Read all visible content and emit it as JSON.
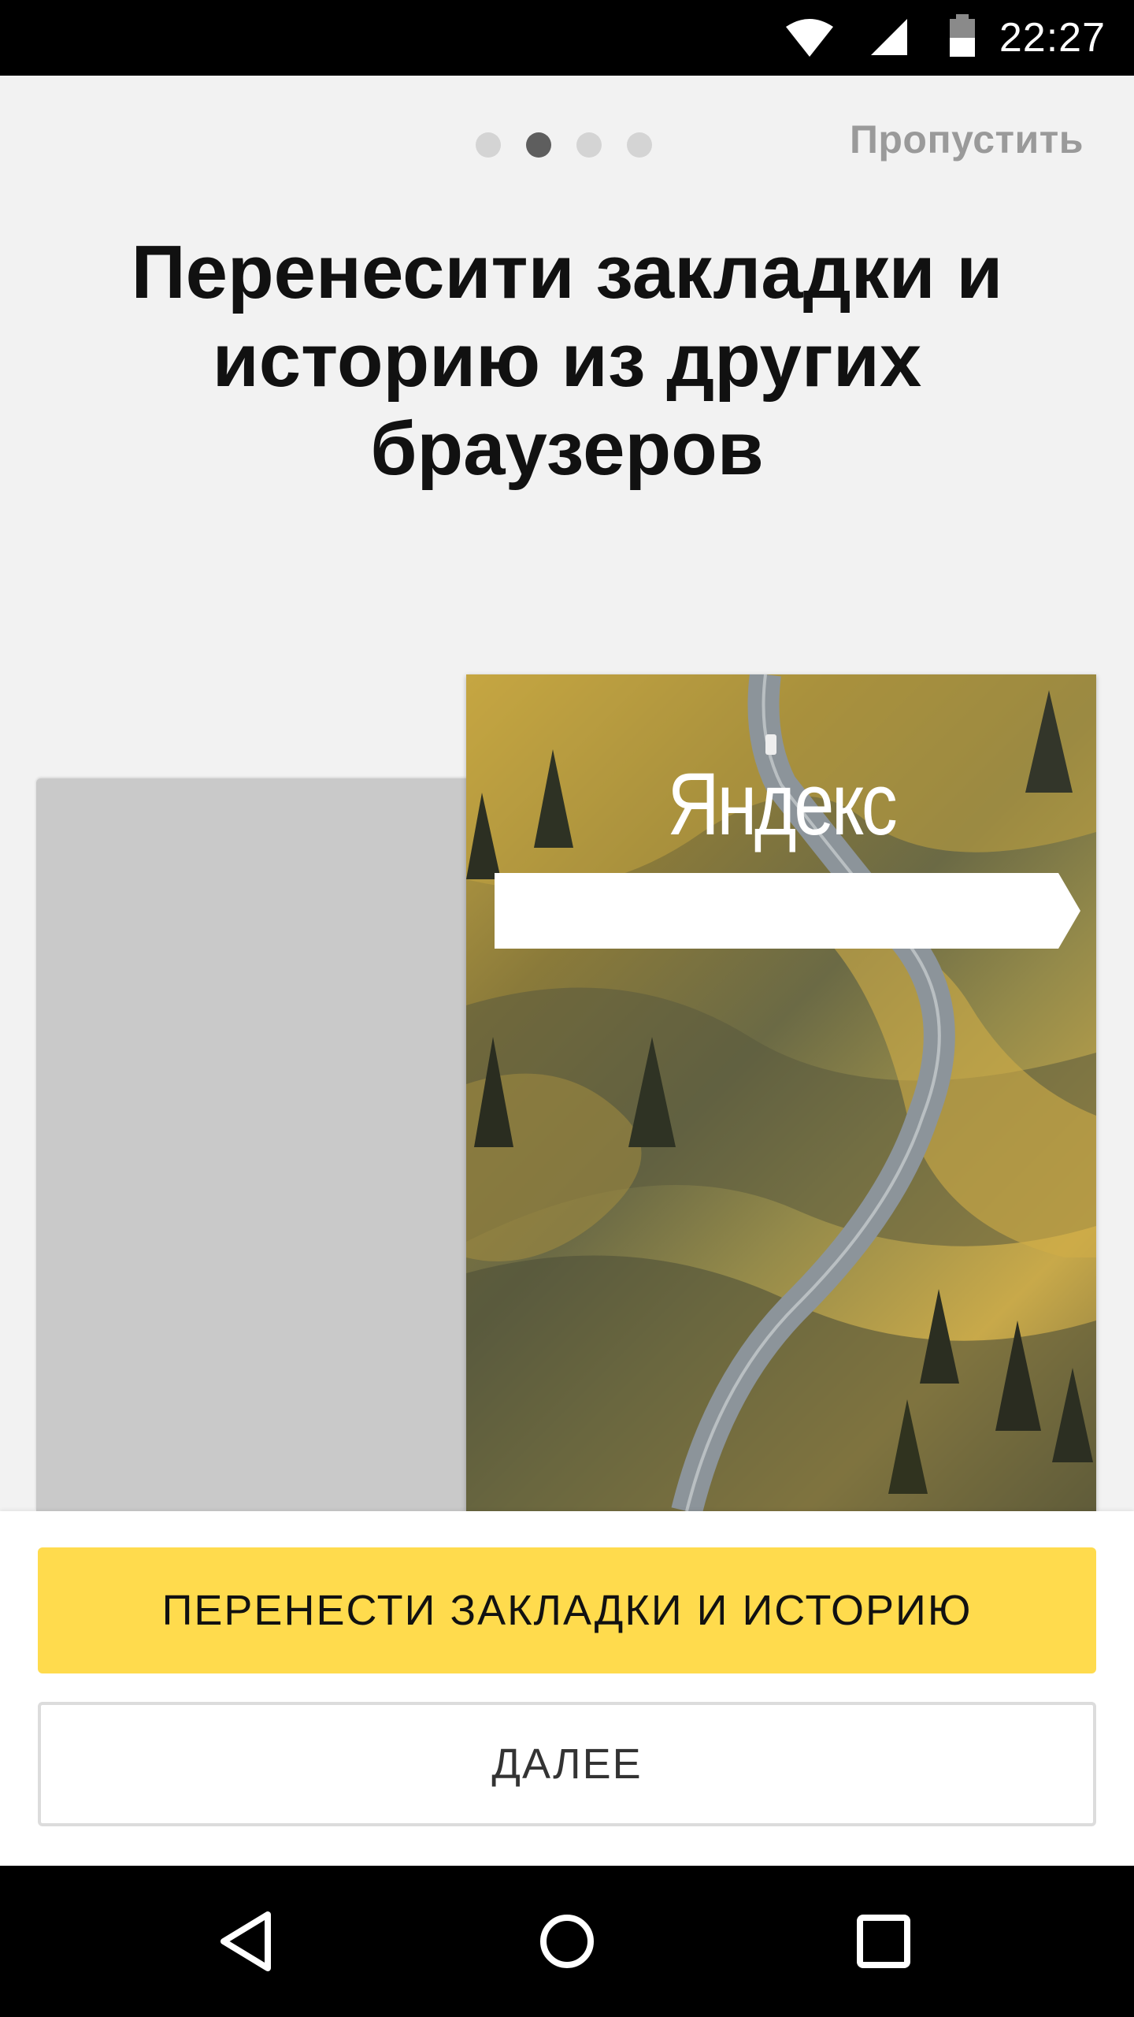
{
  "status_bar": {
    "time": "22:27",
    "icons": [
      "wifi-icon",
      "cell-signal-icon",
      "battery-icon"
    ]
  },
  "pager": {
    "total": 4,
    "active_index": 1
  },
  "header": {
    "skip_label": "Пропустить"
  },
  "title": "Перенесити закладки и историю из других браузеров",
  "illustration": {
    "logo_text": "Яндекс"
  },
  "actions": {
    "primary_label": "ПЕРЕНЕСТИ ЗАКЛАДКИ И ИСТОРИЮ",
    "secondary_label": "ДАЛЕЕ"
  },
  "nav_bar": {
    "icons": [
      "back-icon",
      "home-icon",
      "recents-icon"
    ]
  },
  "colors": {
    "accent": "#ffdb4d",
    "background": "#f2f2f2",
    "placeholder_card": "#c9c9c9"
  }
}
